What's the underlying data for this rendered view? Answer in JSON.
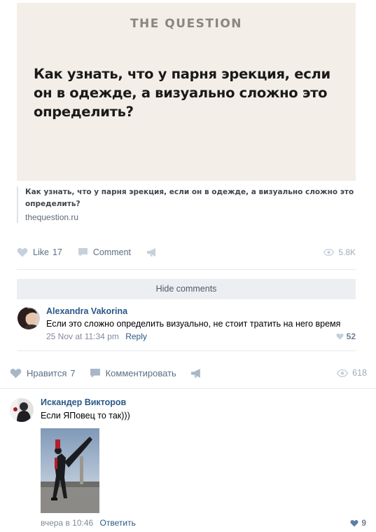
{
  "post": {
    "brand": "THE QUESTION",
    "cover_title": "Как узнать, что у парня эрекция, если он в одежде, а визуально сложно это определить?",
    "link_title": "Как узнать, что у парня эрекция, если он в одежде, а визуально сложно это определить?",
    "link_domain": "thequestion.ru",
    "like_label": "Like",
    "like_count": "17",
    "comment_label": "Comment",
    "views": "5.8K",
    "hide_comments": "Hide comments"
  },
  "inner_comment": {
    "author": "Alexandra Vakorina",
    "text": "Если это сложно определить визуально, не стоит тратить на него время",
    "time": "25 Nov at 11:34 pm",
    "reply": "Reply",
    "likes": "52"
  },
  "outer_actions": {
    "like_label": "Нравится",
    "like_count": "7",
    "comment_label": "Комментировать",
    "views": "618"
  },
  "outer_comment": {
    "author": "Искандер Викторов",
    "text": "Если ЯПовец то так)))",
    "time": "вчера в 10:46",
    "reply": "Ответить",
    "likes": "9"
  },
  "colors": {
    "link_blue": "#2a5885",
    "muted": "#828a99",
    "cover_bg": "#f3efe8"
  },
  "icons": [
    "heart-icon",
    "comment-icon",
    "share-icon",
    "eye-icon"
  ]
}
